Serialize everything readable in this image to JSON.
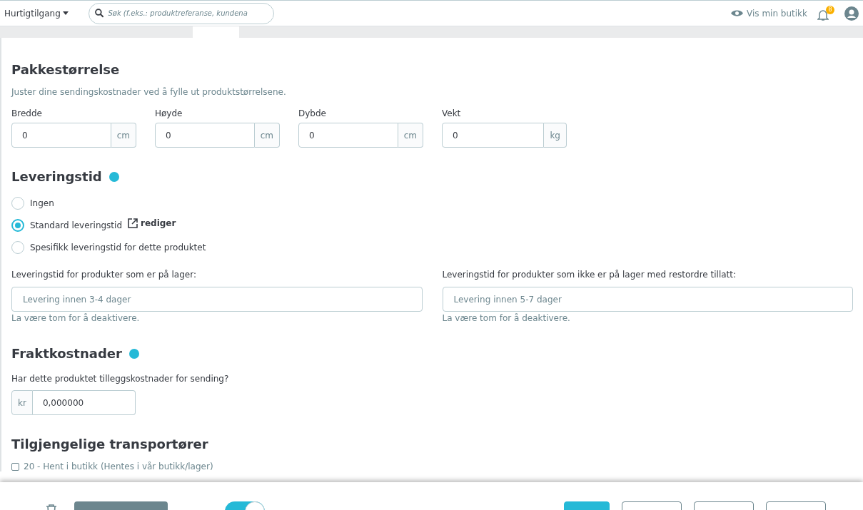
{
  "header": {
    "quick_access": "Hurtigtilgang",
    "search": {
      "placeholder": "Søk (f.eks.: produktreferanse, kundena"
    },
    "view_shop": "Vis min butikk",
    "notifications": "8"
  },
  "package": {
    "title": "Pakkestørrelse",
    "description": "Juster dine sendingskostnader ved å fylle ut produktstørrelsene.",
    "fields": [
      {
        "label": "Bredde",
        "value": "0",
        "unit": "cm"
      },
      {
        "label": "Høyde",
        "value": "0",
        "unit": "cm"
      },
      {
        "label": "Dybde",
        "value": "0",
        "unit": "cm"
      },
      {
        "label": "Vekt",
        "value": "0",
        "unit": "kg"
      }
    ]
  },
  "delivery": {
    "title": "Leveringstid",
    "options": [
      {
        "label": "Ingen",
        "selected": false
      },
      {
        "label": "Standard leveringstid",
        "selected": true,
        "edit_link": "rediger"
      },
      {
        "label": "Spesifikk leveringstid for dette produktet",
        "selected": false
      }
    ],
    "fields": [
      {
        "label": "Leveringstid for produkter som er på lager:",
        "placeholder": "Levering innen 3-4 dager",
        "hint": "La være tom for å deaktivere."
      },
      {
        "label": "Leveringstid for produkter som ikke er på lager med restordre tillatt:",
        "placeholder": "Levering innen 5-7 dager",
        "hint": "La være tom for å deaktivere."
      }
    ]
  },
  "shipping": {
    "title": "Fraktkostnader",
    "question": "Har dette produktet tilleggskostnader for sending?",
    "currency": "kr",
    "value": "0,000000"
  },
  "carriers": {
    "title": "Tilgjengelige transportører",
    "items": [
      {
        "label": "20 - Hent i butikk (Hentes i vår butikk/lager)",
        "checked": false
      }
    ]
  },
  "footer": {
    "online": true,
    "buttons": [
      {
        "kind": "primary"
      },
      {
        "kind": "outline"
      },
      {
        "kind": "outline"
      },
      {
        "kind": "outline"
      }
    ]
  }
}
